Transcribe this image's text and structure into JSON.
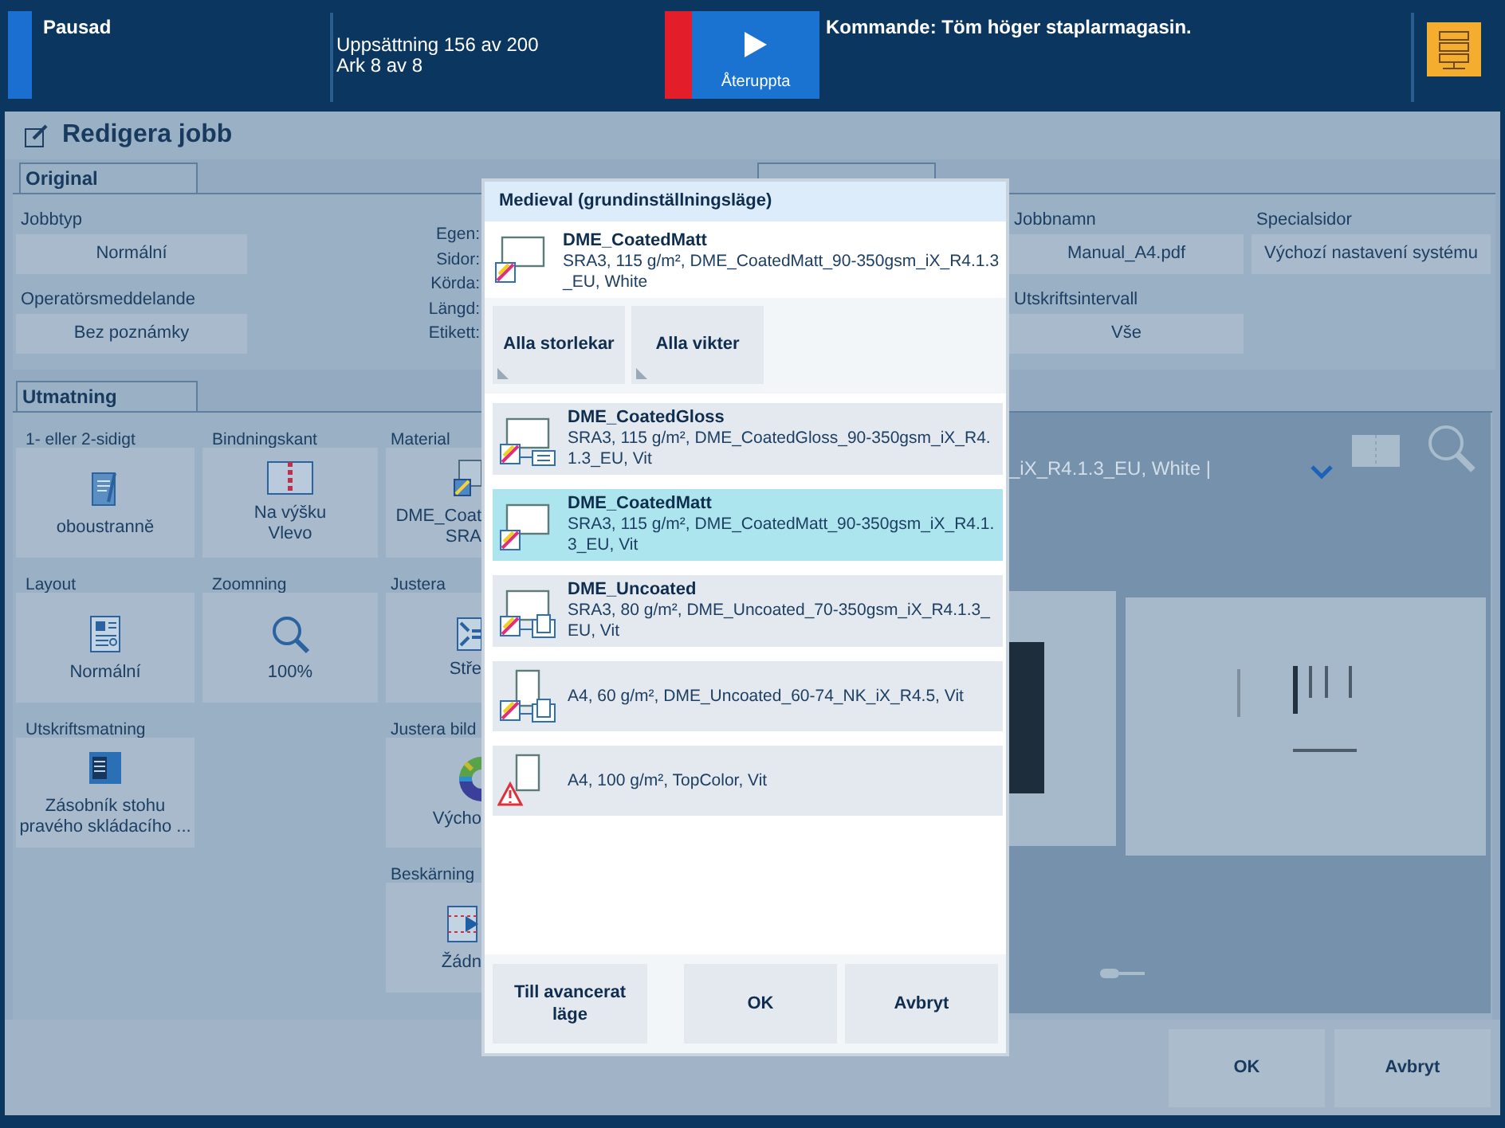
{
  "status_bar": {
    "state": "Pausad",
    "progress_lines": [
      "Uppsättning 156 av 200",
      "Ark 8 av 8"
    ],
    "resume_button": "Återuppta",
    "next_action": "Kommande: Töm höger staplarmagasin."
  },
  "window": {
    "title": "Redigera jobb"
  },
  "original": {
    "tab": "Original",
    "fields": [
      {
        "label": "Jobbtyp",
        "value": "Normální"
      },
      {
        "label": "Operatörsmeddelande",
        "value": "Bez poznámky"
      }
    ],
    "info_labels": [
      "Egen:",
      "Sidor:",
      "Körda:",
      "Längd:",
      "Etikett:"
    ]
  },
  "job": {
    "fields": [
      {
        "label": "Jobbnamn",
        "value": "Manual_A4.pdf"
      },
      {
        "label": "Specialsidor",
        "value": "Výchozí nastavení systému"
      },
      {
        "label": "Utskriftsintervall",
        "value": "Vše"
      }
    ]
  },
  "output": {
    "tab": "Utmatning",
    "rows": [
      [
        {
          "kind": "setting",
          "label": "1- eller 2-sidigt",
          "lines": [
            "oboustranně"
          ]
        },
        {
          "kind": "setting",
          "label": "Bindningskant",
          "lines": [
            "Na výšku",
            "Vlevo"
          ]
        },
        {
          "kind": "setting",
          "label": "Material",
          "lines": [
            "DME_Coat",
            "SRA"
          ]
        }
      ],
      [
        {
          "kind": "setting",
          "label": "Layout",
          "lines": [
            "Normální"
          ]
        },
        {
          "kind": "setting",
          "label": "Zoomning",
          "lines": [
            "100%"
          ]
        },
        {
          "kind": "setting",
          "label": "Justera",
          "lines": [
            "Stře"
          ]
        }
      ],
      [
        {
          "kind": "setting",
          "label": "Utskriftsmatning",
          "lines": [
            "Zásobník stohu",
            "pravého skládacího ..."
          ]
        },
        {
          "kind": "empty"
        },
        {
          "kind": "setting",
          "label": "Justera bild",
          "lines": [
            "Výcho"
          ]
        }
      ],
      [
        {
          "kind": "empty"
        },
        {
          "kind": "empty"
        },
        {
          "kind": "setting",
          "label": "Beskärning",
          "lines": [
            "Žádn"
          ]
        }
      ]
    ]
  },
  "preview": {
    "media_text": "_iX_R4.1.3_EU, White |"
  },
  "footer_buttons": [
    "OK",
    "Avbryt"
  ],
  "media_dialog": {
    "title": "Medieval (grundinställningsläge)",
    "current": {
      "name": "DME_CoatedMatt",
      "details": "SRA3, 115 g/m², DME_CoatedMatt_90-350gsm_iX_R4.1.3_EU, White"
    },
    "filters": [
      "Alla storlekar",
      "Alla vikter"
    ],
    "media": [
      {
        "kind": "glossy",
        "name": "DME_CoatedGloss",
        "details": "SRA3, 115 g/m², DME_CoatedGloss_90-350gsm_iX_R4.1.3_EU, Vit",
        "selected": false
      },
      {
        "kind": "plain",
        "name": "DME_CoatedMatt",
        "details": "SRA3, 115 g/m², DME_CoatedMatt_90-350gsm_iX_R4.1.3_EU, Vit",
        "selected": true
      },
      {
        "kind": "stacked",
        "name": "DME_Uncoated",
        "details": "SRA3, 80 g/m², DME_Uncoated_70-350gsm_iX_R4.1.3_EU, Vit",
        "selected": false
      },
      {
        "kind": "portrait",
        "details": "A4, 60 g/m², DME_Uncoated_60-74_NK_iX_R4.5, Vit",
        "selected": false
      },
      {
        "kind": "warning",
        "details": "A4, 100 g/m², TopColor, Vit",
        "selected": false
      }
    ],
    "buttons": [
      "Till avancerat läge",
      "OK",
      "Avbryt"
    ]
  }
}
